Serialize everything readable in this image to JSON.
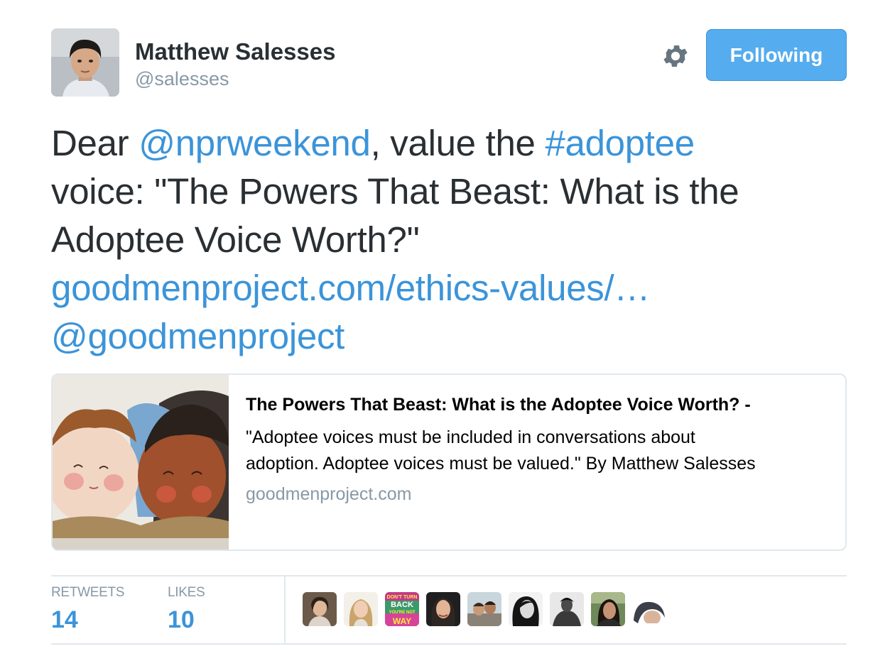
{
  "author": {
    "name": "Matthew Salesses",
    "handle": "@salesses",
    "avatar_icon": "author-avatar"
  },
  "actions": {
    "settings_icon": "gear-icon",
    "follow_label": "Following",
    "follow_color": "#55acee"
  },
  "tweet": {
    "text_start": "Dear ",
    "mention_1": "@nprweekend",
    "text_mid": ", value the ",
    "hashtag": "#adoptee",
    "line2": "voice: \"The Powers That Beast: What is the",
    "line3": "Adoptee Voice Worth?\"",
    "url": "goodmenproject.com/ethics-values/…",
    "mention_2": "@goodmenproject",
    "link_color": "#3b94d9",
    "text_color": "#292f33"
  },
  "card": {
    "title": "The Powers That Beast: What is the Adoptee Voice Worth? -",
    "desc_line1": "\"Adoptee voices must be included in conversations about",
    "desc_line2": "adoption. Adoptee voices must be valued.\" By Matthew Salesses",
    "domain": "goodmenproject.com",
    "image_icon": "dolls-thumbnail"
  },
  "stats": {
    "retweets_label": "RETWEETS",
    "retweets_count": "14",
    "likes_label": "LIKES",
    "likes_count": "10"
  },
  "likers": [
    {
      "icon": "liker-avatar-1"
    },
    {
      "icon": "liker-avatar-2"
    },
    {
      "icon": "liker-avatar-3",
      "text_top": "DON'T TURN",
      "text_mid": "BACK",
      "text_low": "YOU'RE NOT",
      "text_bottom": "WAY"
    },
    {
      "icon": "liker-avatar-4"
    },
    {
      "icon": "liker-avatar-5"
    },
    {
      "icon": "liker-avatar-6"
    },
    {
      "icon": "liker-avatar-7"
    },
    {
      "icon": "liker-avatar-8"
    },
    {
      "icon": "liker-avatar-9"
    }
  ]
}
